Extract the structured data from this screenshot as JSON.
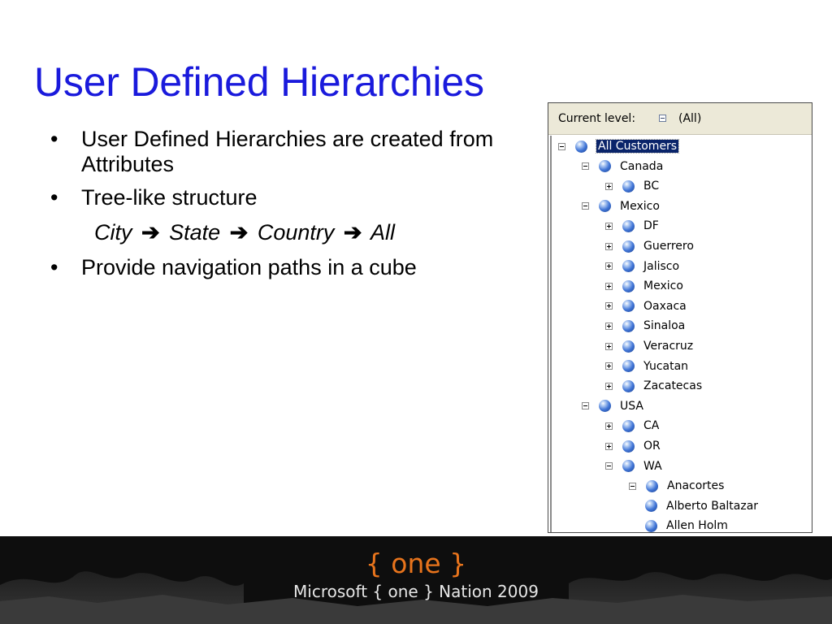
{
  "slide": {
    "title": "User Defined Hierarchies",
    "bullets": [
      "User Defined Hierarchies are created from Attributes",
      "Tree-like structure",
      "Provide navigation paths in a cube"
    ],
    "path": [
      "City",
      "State",
      "Country",
      "All"
    ]
  },
  "tree_panel": {
    "current_level_label": "Current level:",
    "current_level_value": "(All)",
    "nodes": [
      {
        "label": "All Customers",
        "depth": 0,
        "expander": "minus",
        "selected": true
      },
      {
        "label": "Canada",
        "depth": 1,
        "expander": "minus"
      },
      {
        "label": "BC",
        "depth": 2,
        "expander": "plus"
      },
      {
        "label": "Mexico",
        "depth": 1,
        "expander": "minus"
      },
      {
        "label": "DF",
        "depth": 2,
        "expander": "plus"
      },
      {
        "label": "Guerrero",
        "depth": 2,
        "expander": "plus"
      },
      {
        "label": "Jalisco",
        "depth": 2,
        "expander": "plus"
      },
      {
        "label": "Mexico",
        "depth": 2,
        "expander": "plus"
      },
      {
        "label": "Oaxaca",
        "depth": 2,
        "expander": "plus"
      },
      {
        "label": "Sinaloa",
        "depth": 2,
        "expander": "plus"
      },
      {
        "label": "Veracruz",
        "depth": 2,
        "expander": "plus"
      },
      {
        "label": "Yucatan",
        "depth": 2,
        "expander": "plus"
      },
      {
        "label": "Zacatecas",
        "depth": 2,
        "expander": "plus"
      },
      {
        "label": "USA",
        "depth": 1,
        "expander": "minus"
      },
      {
        "label": "CA",
        "depth": 2,
        "expander": "plus"
      },
      {
        "label": "OR",
        "depth": 2,
        "expander": "plus"
      },
      {
        "label": "WA",
        "depth": 2,
        "expander": "minus"
      },
      {
        "label": "Anacortes",
        "depth": 3,
        "expander": "minus"
      },
      {
        "label": "Alberto Baltazar",
        "depth": 4,
        "expander": "none"
      },
      {
        "label": "Allen Holm",
        "depth": 4,
        "expander": "none"
      }
    ]
  },
  "footer": {
    "logo": "{ one }",
    "subtitle": "Microsoft { one } Nation 2009"
  },
  "colors": {
    "title": "#1a1adc",
    "logo": "#e8741c",
    "selection": "#0a246a"
  },
  "icons": {
    "arrow": "right-arrow-icon",
    "tree_node": "blue-sphere-icon",
    "expander": "plus-minus-box-icon"
  }
}
